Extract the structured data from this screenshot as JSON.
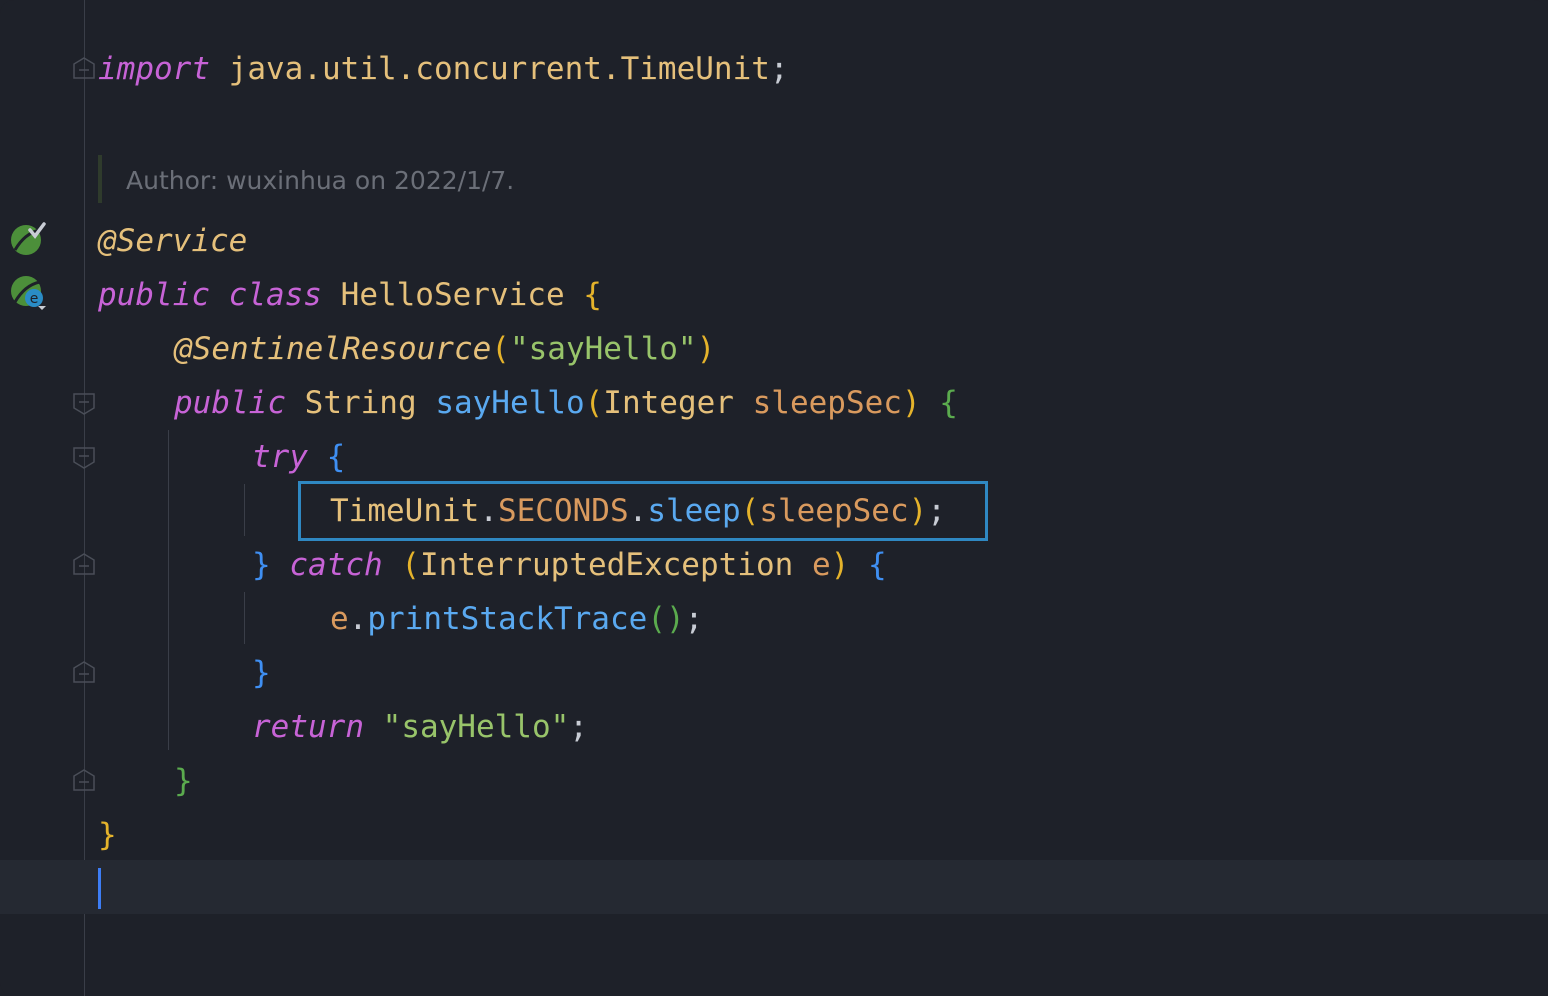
{
  "editor": {
    "author_note": "Author: wuxinhua on 2022/1/7.",
    "code": {
      "import_kw": "import",
      "import_path": "java.util.concurrent.TimeUnit",
      "semicolon": ";",
      "service_ann": "@Service",
      "public_kw": "public",
      "class_kw": "class",
      "class_name": "HelloService",
      "sentinel_ann": "@SentinelResource",
      "sentinel_arg": "\"sayHello\"",
      "string_type": "String",
      "method_name": "sayHello",
      "integer_type": "Integer",
      "param_name": "sleepSec",
      "try_kw": "try",
      "timeunit": "TimeUnit",
      "seconds": "SECONDS",
      "sleep": "sleep",
      "catch_kw": "catch",
      "exception_type": "InterruptedException",
      "exception_var": "e",
      "print_stack": "printStackTrace",
      "return_kw": "return",
      "return_value": "\"sayHello\"",
      "dot": ".",
      "open_brace": "{",
      "close_brace": "}",
      "open_paren": "(",
      "close_paren": ")",
      "empty_parens": "()"
    }
  },
  "colors": {
    "background": "#1e2129",
    "keyword": "#c763d6",
    "annotation": "#e5c07b",
    "method": "#5aa9f0",
    "string": "#98c46a",
    "highlight_border": "#2f88c2",
    "caret": "#3d7df5"
  },
  "icons": {
    "spring_bean": "spring-bean-check-icon",
    "spring_bean_override": "spring-bean-override-icon"
  }
}
